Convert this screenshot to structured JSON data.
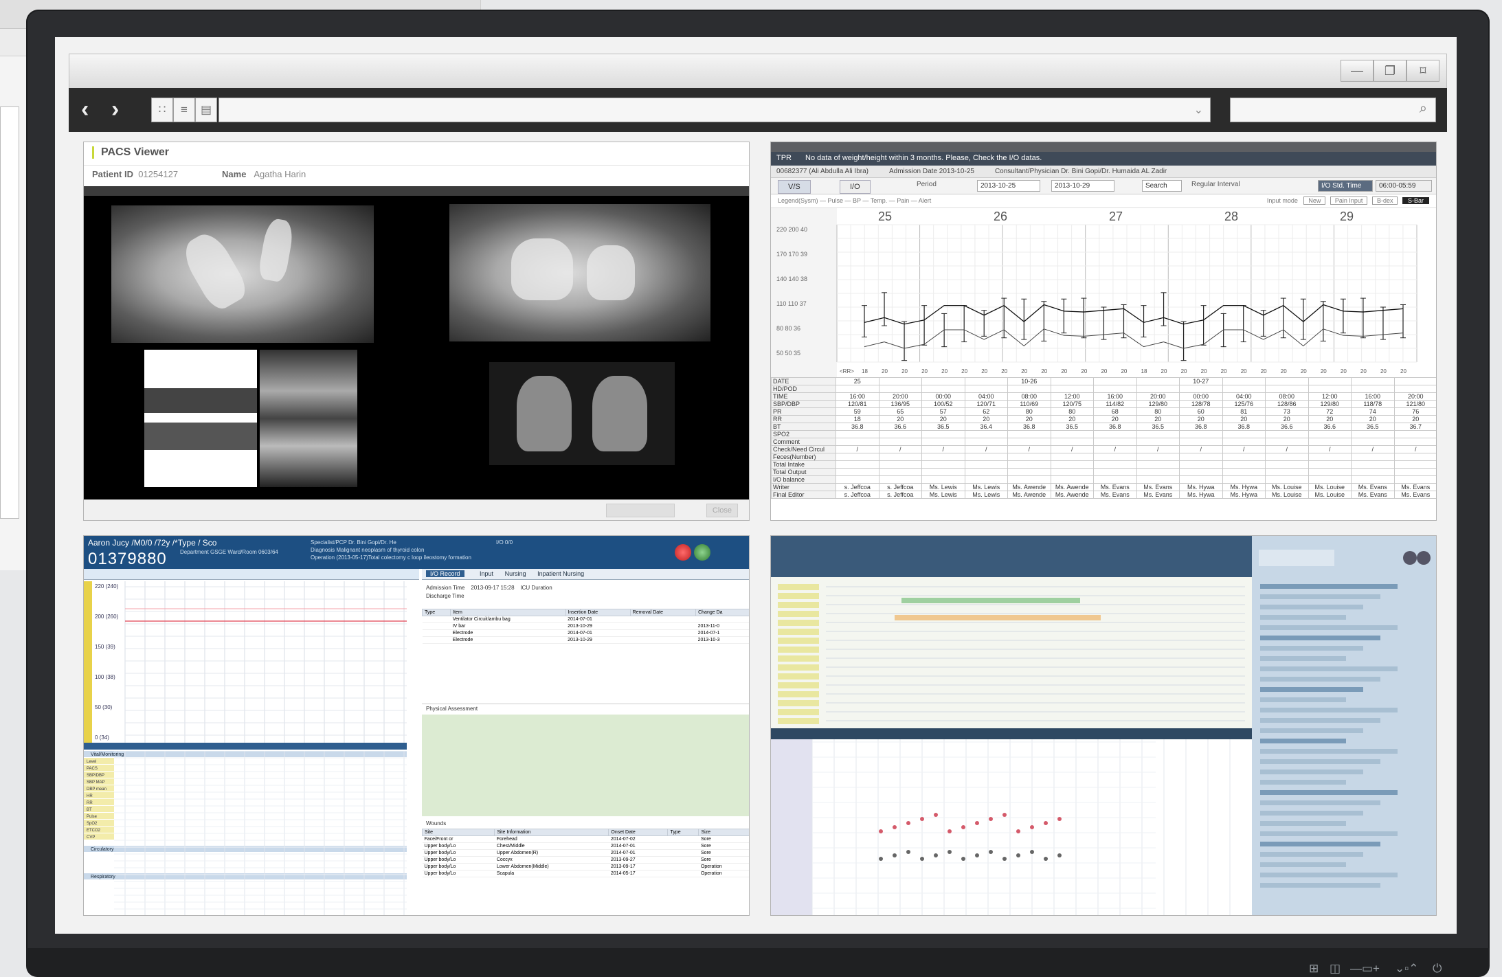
{
  "window": {
    "minimize_icon": "minimize-icon",
    "restore_icon": "restore-icon",
    "close_icon": "close-icon"
  },
  "toolbar": {
    "back_icon": "back-icon",
    "forward_icon": "forward-icon",
    "view_icons": [
      "grid-icon",
      "list-icon",
      "document-icon"
    ],
    "search_icon": "search-icon"
  },
  "pacs": {
    "title": "PACS Viewer",
    "patient_id_label": "Patient ID",
    "patient_id": "01254127",
    "name_label": "Name",
    "name": "Agatha Harin",
    "close_button": "Close"
  },
  "tpr": {
    "tab_title": "TPR",
    "notice": "No data of weight/height within 3 months. Please, Check the I/O datas.",
    "patient": "00682377 (Ali Abdulla Ali Ibra)",
    "admission": "Admission Date 2013-10-25",
    "consultant": "Consultant/Physician Dr. Bini Gopi/Dr. Humaida AL Zadir",
    "tabs": [
      "V/S",
      "I/O"
    ],
    "period_label": "Period",
    "date_from": "2013-10-25",
    "date_to": "2013-10-29",
    "search_label": "Search",
    "regular_interval": "Regular Interval",
    "io_std_time": "I/O Std. Time",
    "time_value": "06:00-05:59",
    "legend": "Legend(Sysm) — Pulse — BP — Temp. — Pain — Alert",
    "input_mode": "Input mode",
    "new_btn": "New",
    "pain_btn": "Pain Input",
    "bio_btn": "B-dex",
    "sbar_btn": "S-Bar",
    "days": [
      "25",
      "26",
      "27",
      "28",
      "29"
    ],
    "row_labels": [
      "DATE",
      "HD/POD",
      "TIME",
      "SBP/DBP",
      "PR",
      "RR",
      "BT",
      "SPO2",
      "Comment",
      "Check/Need Circul",
      "Feces(Number)",
      "Total Intake",
      "Total Output",
      "I/O balance",
      "Writer",
      "Final Editor"
    ],
    "times": [
      "16:00",
      "20:00",
      "00:00",
      "04:00",
      "08:00",
      "12:00",
      "16:00",
      "20:00",
      "00:00",
      "04:00",
      "08:00",
      "12:00",
      "16:00",
      "20:00"
    ],
    "sbp": [
      "120/81",
      "136/95",
      "100/52",
      "120/71",
      "110/69",
      "120/75",
      "114/82",
      "129/80",
      "128/78",
      "125/76",
      "128/86",
      "129/80",
      "118/78",
      "121/80"
    ],
    "pr": [
      "59",
      "65",
      "57",
      "62",
      "80",
      "80",
      "68",
      "80",
      "60",
      "81",
      "73",
      "72",
      "74",
      "76"
    ],
    "rr": [
      "18",
      "20",
      "20",
      "20",
      "20",
      "20",
      "20",
      "20",
      "20",
      "20",
      "20",
      "20",
      "20",
      "20"
    ],
    "bt": [
      "36.8",
      "36.6",
      "36.5",
      "36.4",
      "36.8",
      "36.5",
      "36.8",
      "36.5",
      "36.8",
      "36.8",
      "36.6",
      "36.6",
      "36.5",
      "36.7"
    ],
    "writers": [
      "s. Jeffcoa",
      "s. Jeffcoa",
      "Ms. Lewis",
      "Ms. Lewis",
      "Ms. Awende",
      "Ms. Awende",
      "Ms. Evans",
      "Ms. Evans",
      "Ms. Hywa",
      "Ms. Hywa",
      "Ms. Louise",
      "Ms. Louise",
      "Ms. Evans",
      "Ms. Evans"
    ],
    "chart_colors": {
      "pulse": "#111111",
      "bp": "#111111"
    }
  },
  "flowsheet": {
    "patient_header": "Aaron Jucy /M0/0 /72y /*Type / Sco",
    "patient_no": "01379880",
    "department": "Department GSGE Ward/Room 0603/64",
    "specialist": "Specialist/PCP Dr. Bini Gopi/Dr. He",
    "diagnosis": "Diagnosis Malignant neoplasm of thyroid colon",
    "operation": "Operation (2013-05-17)Total colectomy c loop ileostomy formation",
    "io": "I/O 0/0",
    "y_labels": [
      "220 (240)",
      "200 (260)",
      "150 (39)",
      "100 (38)",
      "50 (30)",
      "0 (34)"
    ],
    "sections": [
      "Vital/Monitoring",
      "Circulatory",
      "Respiratory"
    ],
    "vital_rows": [
      "Level",
      "PACS",
      "SBP/DBP",
      "SBP MAP",
      "DBP mean",
      "HR",
      "RR",
      "BT",
      "Pulse",
      "SpO2",
      "ETCO2",
      "CVP"
    ],
    "right_tabs": [
      "I/O Record",
      "Input",
      "Nursing",
      "Inpatient Nursing"
    ],
    "admission_time_label": "Admission Time",
    "admission_time": "2013-09-17 15:28",
    "icu_duration": "ICU Duration",
    "discharge_time_label": "Discharge Time",
    "line_cols": [
      "Type",
      "Item",
      "Insertion Date",
      "Removal Date",
      "Change Da"
    ],
    "lines": [
      [
        "",
        "Ventilator Circuit/ambu bag",
        "2014-07-01",
        "",
        ""
      ],
      [
        "",
        "IV bar",
        "2013-10-29",
        "",
        "2013-11-0"
      ],
      [
        "",
        "Electrode",
        "2014-07-01",
        "",
        "2014-07-1"
      ],
      [
        "",
        "Electrode",
        "2013-10-29",
        "",
        "2013-10-3"
      ]
    ],
    "physical_assessment": "Physical Assessment",
    "wounds_label": "Wounds",
    "wound_cols": [
      "Site",
      "Site Information",
      "Onset Date",
      "Type",
      "Size"
    ],
    "wounds": [
      [
        "Face/Front or",
        "Forehead",
        "2014-07-02",
        "",
        "Sore"
      ],
      [
        "Upper body/Lo",
        "Chest/Middle",
        "2014-07-01",
        "",
        "Sore"
      ],
      [
        "Upper body/Lo",
        "Upper Abdomen(R)",
        "2014-07-01",
        "",
        "Sore"
      ],
      [
        "Upper body/Lo",
        "Coccyx",
        "2013-09-27",
        "",
        "Sore"
      ],
      [
        "Upper body/Lo",
        "Lower Abdomen(Middle)",
        "2013-09-17",
        "",
        "Operation"
      ],
      [
        "Upper body/Lo",
        "Scapula",
        "2014-05-17",
        "",
        "Operation"
      ]
    ]
  }
}
